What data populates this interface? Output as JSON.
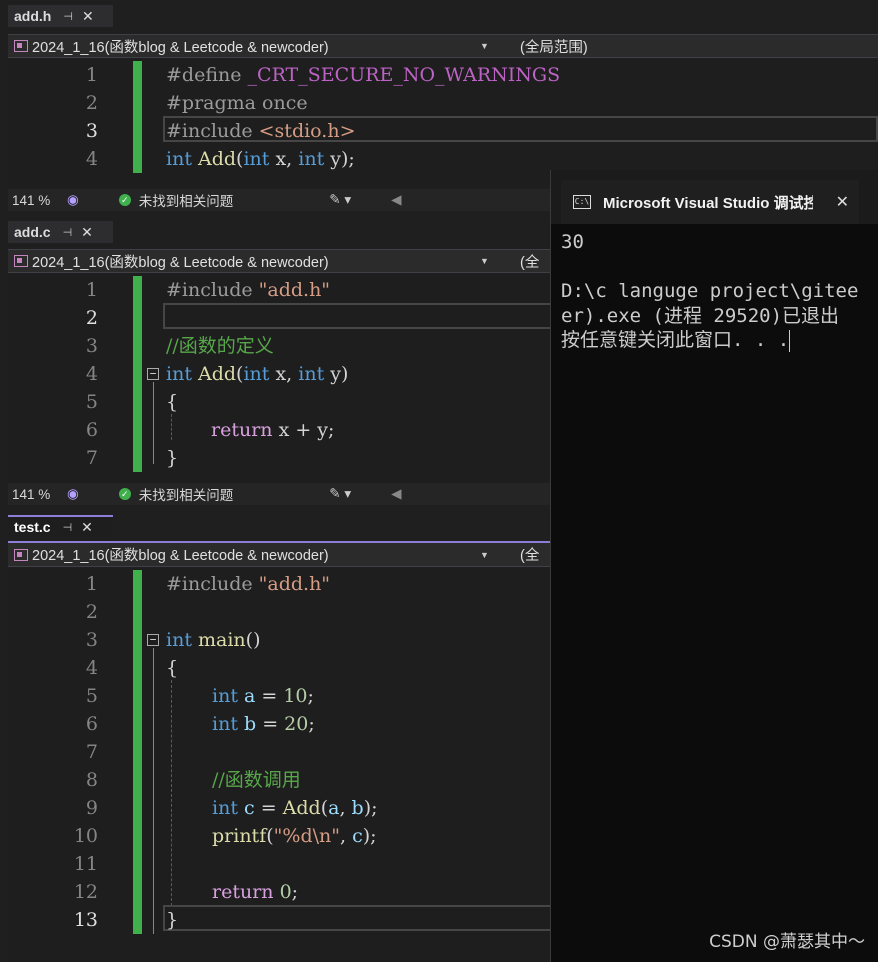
{
  "editors": [
    {
      "tab": {
        "label": "add.h",
        "pin": "⊣",
        "close": "✕"
      },
      "nav": {
        "project": "2024_1_16(函数blog & Leetcode & newcoder)",
        "scope": "(全局范围)"
      },
      "lines": [
        {
          "n": "1",
          "t": "#define _CRT_SECURE_NO_WARNINGS"
        },
        {
          "n": "2",
          "t": "#pragma once"
        },
        {
          "n": "3",
          "t": "#include <stdio.h>"
        },
        {
          "n": "4",
          "t": "int Add(int x, int y);"
        }
      ],
      "status": {
        "zoom": "141 %",
        "issues": "未找到相关问题"
      }
    },
    {
      "tab": {
        "label": "add.c",
        "pin": "⊣",
        "close": "✕"
      },
      "nav": {
        "project": "2024_1_16(函数blog & Leetcode & newcoder)",
        "scope": "(全"
      },
      "lines": [
        {
          "n": "1",
          "t": "#include \"add.h\""
        },
        {
          "n": "2",
          "t": ""
        },
        {
          "n": "3",
          "t": "//函数的定义"
        },
        {
          "n": "4",
          "t": "int Add(int x, int y)"
        },
        {
          "n": "5",
          "t": "{"
        },
        {
          "n": "6",
          "t": "return x + y;"
        },
        {
          "n": "7",
          "t": "}"
        }
      ],
      "status": {
        "zoom": "141 %",
        "issues": "未找到相关问题"
      }
    },
    {
      "tab": {
        "label": "test.c",
        "pin": "⊣",
        "close": "✕"
      },
      "nav": {
        "project": "2024_1_16(函数blog & Leetcode & newcoder)",
        "scope": "(全"
      },
      "lines": [
        {
          "n": "1",
          "t": "#include \"add.h\""
        },
        {
          "n": "2",
          "t": ""
        },
        {
          "n": "3",
          "t": "int main()"
        },
        {
          "n": "4",
          "t": "{"
        },
        {
          "n": "5",
          "t": "int a = 10;"
        },
        {
          "n": "6",
          "t": "int b = 20;"
        },
        {
          "n": "7",
          "t": ""
        },
        {
          "n": "8",
          "t": "//函数调用"
        },
        {
          "n": "9",
          "t": "int c = Add(a, b);"
        },
        {
          "n": "10",
          "t": "printf(\"%d\\n\", c);"
        },
        {
          "n": "11",
          "t": ""
        },
        {
          "n": "12",
          "t": "return 0;"
        },
        {
          "n": "13",
          "t": "}"
        }
      ]
    }
  ],
  "console": {
    "title": "Microsoft Visual Studio 调试控",
    "close": "✕",
    "icon": "C:\\",
    "output": [
      "30",
      "",
      "D:\\c languge project\\gitee",
      "er).exe (进程 29520)已退出",
      "按任意键关闭此窗口. . ."
    ]
  },
  "watermark": "CSDN @萧瑟其中～"
}
